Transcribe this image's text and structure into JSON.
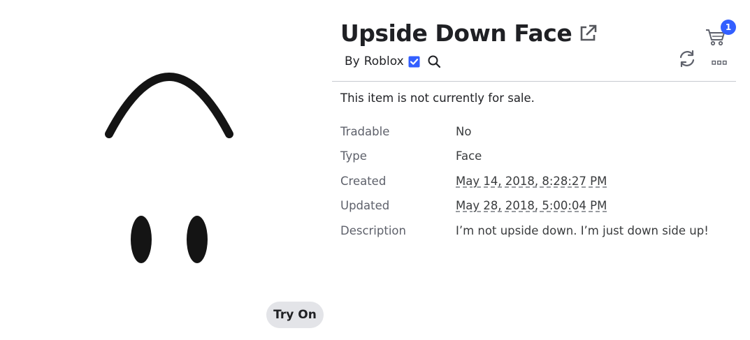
{
  "item": {
    "title": "Upside Down Face",
    "creator_prefix": "By",
    "creator_name": "Roblox",
    "sale_status": "This item is not currently for sale."
  },
  "details": [
    {
      "label": "Tradable",
      "value": "No"
    },
    {
      "label": "Type",
      "value": "Face"
    },
    {
      "label": "Created",
      "value": "May 14, 2018, 8:28:27 PM"
    },
    {
      "label": "Updated",
      "value": "May 28, 2018, 5:00:04 PM"
    },
    {
      "label": "Description",
      "value": "I’m not upside down. I’m just down side up!"
    }
  ],
  "thumbnail": {
    "try_on_label": "Try On"
  },
  "header": {
    "cart_count": "1"
  },
  "icons": {
    "external_link": "external-link-icon",
    "verified": "verified-badge-icon",
    "search": "search-icon",
    "cart": "cart-icon",
    "refresh": "refresh-icon",
    "more": "more-options-icon"
  },
  "colors": {
    "verified_blue": "#335fff",
    "badge_blue": "#335fff",
    "try_on_bg": "#e3e4e8",
    "divider": "#c7c9cf"
  }
}
